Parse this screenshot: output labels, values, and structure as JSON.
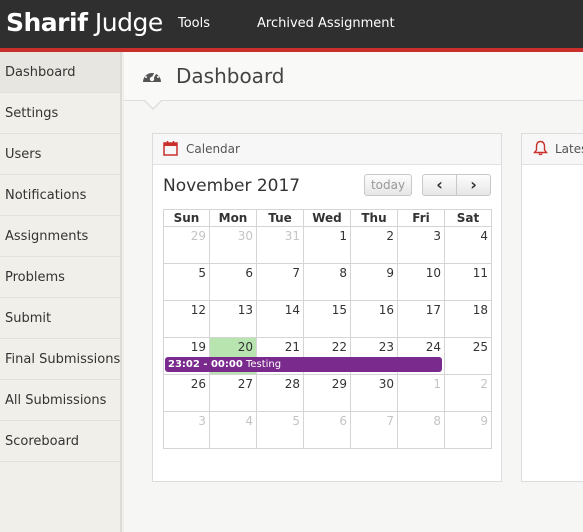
{
  "app": {
    "brand_bold": "Sharif",
    "brand_light": " Judge"
  },
  "topnav": {
    "tools": "Tools",
    "archived": "Archived Assignment"
  },
  "sidebar": {
    "items": [
      {
        "label": "Dashboard"
      },
      {
        "label": "Settings"
      },
      {
        "label": "Users"
      },
      {
        "label": "Notifications"
      },
      {
        "label": "Assignments"
      },
      {
        "label": "Problems"
      },
      {
        "label": "Submit"
      },
      {
        "label": "Final Submissions"
      },
      {
        "label": "All Submissions"
      },
      {
        "label": "Scoreboard"
      }
    ]
  },
  "page": {
    "title": "Dashboard"
  },
  "calendar": {
    "widget_title": "Calendar",
    "month": "November 2017",
    "today_label": "today",
    "prev_glyph": "‹",
    "next_glyph": "›",
    "weekdays": [
      "Sun",
      "Mon",
      "Tue",
      "Wed",
      "Thu",
      "Fri",
      "Sat"
    ],
    "weeks": [
      [
        "29",
        "30",
        "31",
        "1",
        "2",
        "3",
        "4"
      ],
      [
        "5",
        "6",
        "7",
        "8",
        "9",
        "10",
        "11"
      ],
      [
        "12",
        "13",
        "14",
        "15",
        "16",
        "17",
        "18"
      ],
      [
        "19",
        "20",
        "21",
        "22",
        "23",
        "24",
        "25"
      ],
      [
        "26",
        "27",
        "28",
        "29",
        "30",
        "1",
        "2"
      ],
      [
        "3",
        "4",
        "5",
        "6",
        "7",
        "8",
        "9"
      ]
    ],
    "event": {
      "time": "23:02 - 00:00",
      "title": " Testing",
      "color": "#7a2a8c"
    },
    "today_color": "#b8e4b0"
  },
  "latest": {
    "widget_title": "Lates"
  },
  "colors": {
    "topbar": "#2f2f2f",
    "accent_red": "#c9302c"
  }
}
